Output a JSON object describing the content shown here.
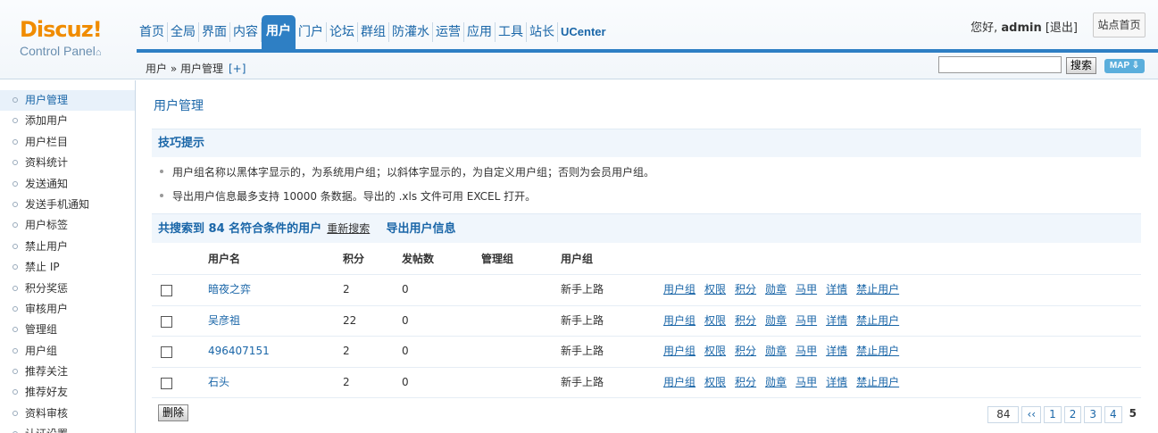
{
  "header": {
    "logo_text": "Discuz!",
    "logo_sub": "Control Panel",
    "logo_home_glyph": "⌂",
    "nav": [
      "首页",
      "全局",
      "界面",
      "内容",
      "用户",
      "门户",
      "论坛",
      "群组",
      "防灌水",
      "运营",
      "应用",
      "工具",
      "站长",
      "UCenter"
    ],
    "active_nav": "用户",
    "greeting": "您好,",
    "username": "admin",
    "logout": "[退出]",
    "site_home": "站点首页",
    "breadcrumb": "用户 » 用户管理",
    "breadcrumb_add": "[+]",
    "search_placeholder": "",
    "search_button": "搜索",
    "map_button": "MAP ⇩"
  },
  "sidebar": {
    "items": [
      "用户管理",
      "添加用户",
      "用户栏目",
      "资料统计",
      "发送通知",
      "发送手机通知",
      "用户标签",
      "禁止用户",
      "禁止 IP",
      "积分奖惩",
      "审核用户",
      "管理组",
      "用户组",
      "推荐关注",
      "推荐好友",
      "资料审核",
      "认证设置"
    ],
    "active_index": 0
  },
  "main": {
    "title": "用户管理",
    "tips_title": "技巧提示",
    "tips": [
      "用户组名称以黑体字显示的，为系统用户组；以斜体字显示的，为自定义用户组；否则为会员用户组。",
      "导出用户信息最多支持 10000 条数据。导出的 .xls 文件可用 EXCEL 打开。"
    ],
    "result_count": "共搜索到 84 名符合条件的用户",
    "research": "重新搜索",
    "export": "导出用户信息",
    "columns": [
      "用户名",
      "积分",
      "发帖数",
      "管理组",
      "用户组"
    ],
    "rows": [
      {
        "name": "暗夜之弈",
        "points": "2",
        "posts": "0",
        "admin_group": "",
        "group": "新手上路"
      },
      {
        "name": "吴彦祖",
        "points": "22",
        "posts": "0",
        "admin_group": "",
        "group": "新手上路"
      },
      {
        "name": "496407151",
        "points": "2",
        "posts": "0",
        "admin_group": "",
        "group": "新手上路"
      },
      {
        "name": "石头",
        "points": "2",
        "posts": "0",
        "admin_group": "",
        "group": "新手上路"
      }
    ],
    "row_actions": [
      "用户组",
      "权限",
      "积分",
      "勋章",
      "马甲",
      "详情",
      "禁止用户"
    ],
    "delete_button": "删除",
    "pager": {
      "total": "84",
      "prev": "‹‹",
      "pages": [
        "1",
        "2",
        "3",
        "4"
      ],
      "current": "5"
    }
  }
}
